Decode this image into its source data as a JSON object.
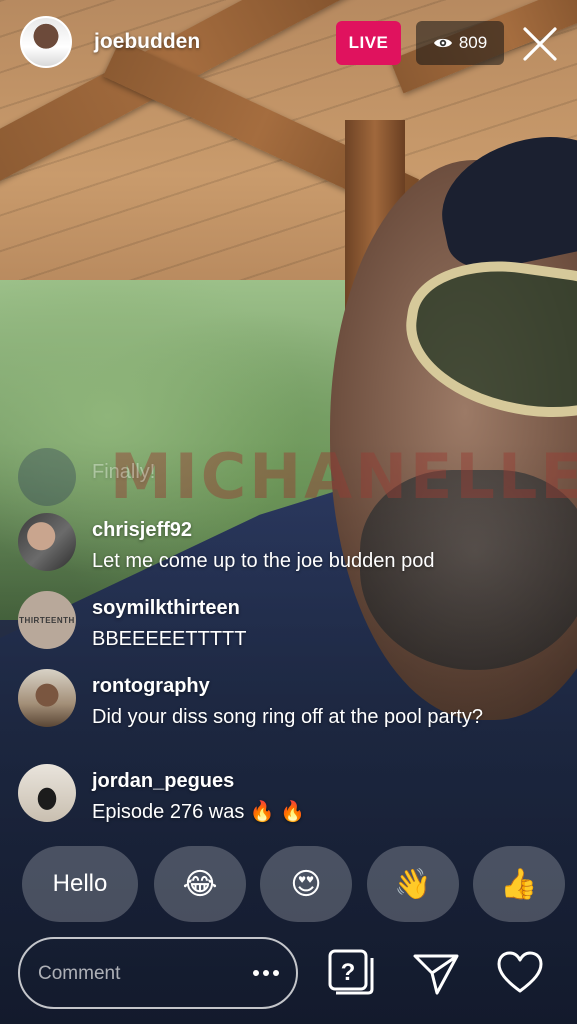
{
  "stream": {
    "host_username": "joebudden",
    "live_label": "LIVE",
    "viewer_count": "809",
    "watermark_text": "MICHANELLE"
  },
  "comments": [
    {
      "username": "",
      "text": "Finally!",
      "faded": true
    },
    {
      "username": "chrisjeff92",
      "text": "Let me come up to the joe budden pod"
    },
    {
      "username": "soymilkthirteen",
      "text": "BBEEEEETTTTT",
      "avatar_text": "THIRTEENTH"
    },
    {
      "username": "rontography",
      "text": "Did your diss song ring off at the pool party?"
    },
    {
      "username": "jordan_pegues",
      "text": "Episode 276 was 🔥 🔥"
    }
  ],
  "quick_replies": [
    {
      "label": "Hello",
      "type": "text"
    },
    {
      "label": "😂",
      "icon": "face-with-tears-of-joy-icon"
    },
    {
      "label": "😍",
      "icon": "heart-eyes-face-icon"
    },
    {
      "label": "👋",
      "icon": "waving-hand-icon"
    },
    {
      "label": "👍",
      "icon": "thumbs-up-icon"
    }
  ],
  "composer": {
    "placeholder": "Comment",
    "more_label": "•••"
  },
  "icons": {
    "close": "close-icon",
    "viewers": "eye-icon",
    "question": "question-box-icon",
    "send": "paper-plane-icon",
    "like": "heart-icon"
  },
  "colors": {
    "live_badge": "#e0125e",
    "viewer_badge": "rgba(20,20,20,0.55)",
    "quick_reply_bg": "rgba(255,255,255,0.22)"
  }
}
